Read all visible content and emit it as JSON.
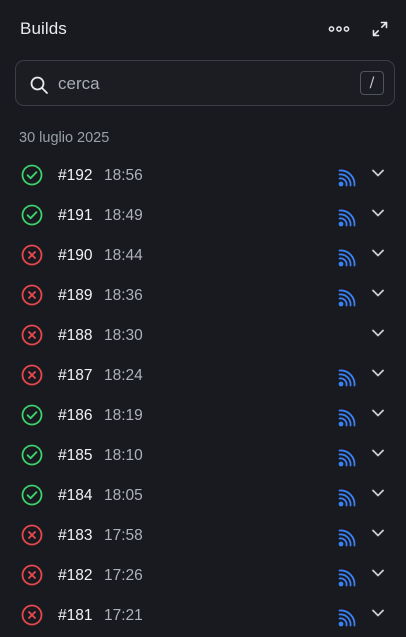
{
  "header": {
    "title": "Builds"
  },
  "search": {
    "placeholder": "cerca",
    "shortcut": "/"
  },
  "date_group": "30 luglio 2025",
  "colors": {
    "success": "#3ecf6b",
    "failure": "#e5484d",
    "device": "#3b82f6"
  },
  "builds": [
    {
      "number": "#192",
      "time": "18:56",
      "status": "success",
      "device": true
    },
    {
      "number": "#191",
      "time": "18:49",
      "status": "success",
      "device": true
    },
    {
      "number": "#190",
      "time": "18:44",
      "status": "failure",
      "device": true
    },
    {
      "number": "#189",
      "time": "18:36",
      "status": "failure",
      "device": true
    },
    {
      "number": "#188",
      "time": "18:30",
      "status": "failure",
      "device": false
    },
    {
      "number": "#187",
      "time": "18:24",
      "status": "failure",
      "device": true
    },
    {
      "number": "#186",
      "time": "18:19",
      "status": "success",
      "device": true
    },
    {
      "number": "#185",
      "time": "18:10",
      "status": "success",
      "device": true
    },
    {
      "number": "#184",
      "time": "18:05",
      "status": "success",
      "device": true
    },
    {
      "number": "#183",
      "time": "17:58",
      "status": "failure",
      "device": true
    },
    {
      "number": "#182",
      "time": "17:26",
      "status": "failure",
      "device": true
    },
    {
      "number": "#181",
      "time": "17:21",
      "status": "failure",
      "device": true
    }
  ]
}
